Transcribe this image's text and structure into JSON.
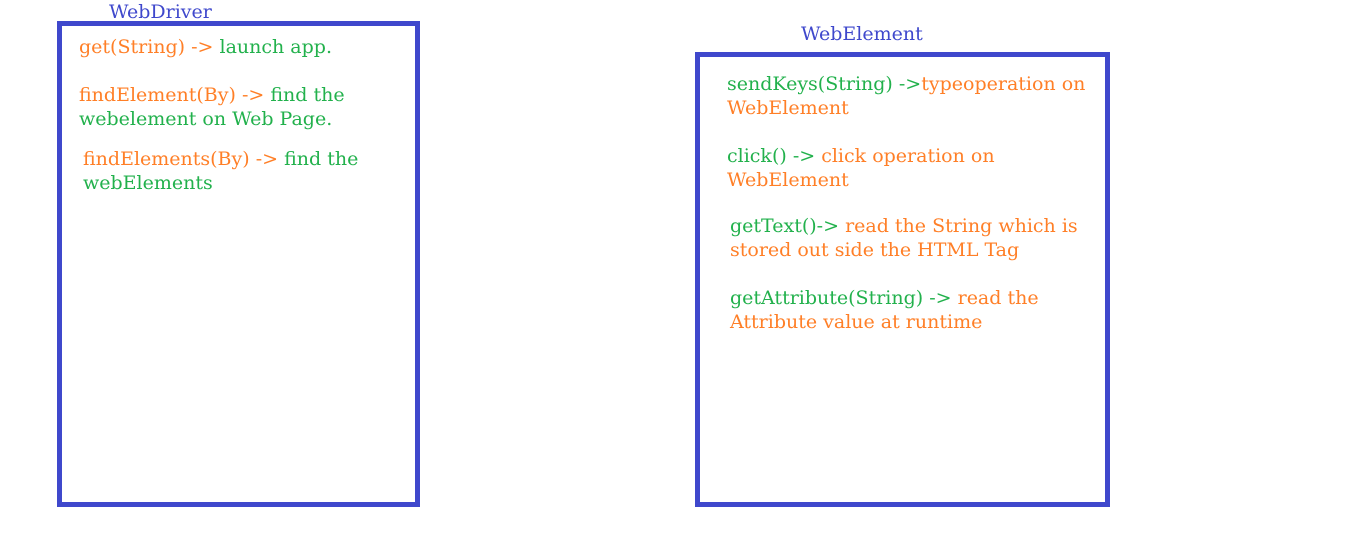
{
  "colors": {
    "frame": "#3f48cc",
    "orange_text": "#ff7f27",
    "green_text": "#22b14c"
  },
  "webdriver": {
    "title": "WebDriver",
    "notes": [
      {
        "method": "get(String)",
        "sep": " -> ",
        "desc": "launch app."
      },
      {
        "method": "findElement(By)",
        "sep": " -> ",
        "desc": "find the",
        "desc2": "webelement on Web Page."
      },
      {
        "method": "findElements(By)",
        "sep": " -> ",
        "desc": "find the",
        "desc2": "webElements"
      }
    ]
  },
  "webelement": {
    "title": "WebElement",
    "notes": [
      {
        "method": "sendKeys(String)",
        "sep": " ->",
        "desc": "typeoperation on",
        "desc2": "WebElement"
      },
      {
        "method": "click()",
        "sep": " -> ",
        "desc": "click operation on",
        "desc2": "WebElement"
      },
      {
        "method": "getText()",
        "sep": "-> ",
        "desc": "read the String which is",
        "desc2": "stored out side the HTML Tag"
      },
      {
        "method": "getAttribute(String)",
        "sep": " -> ",
        "desc": "read the",
        "desc2": "Attribute value at runtime"
      }
    ]
  }
}
